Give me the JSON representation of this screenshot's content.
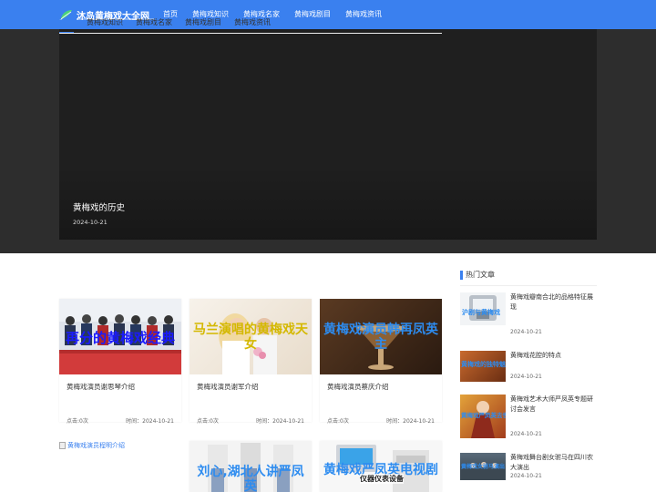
{
  "site": {
    "logo_text": "沐岛黄梅戏大全网"
  },
  "nav": [
    "首页",
    "黄梅戏知识",
    "黄梅戏名家",
    "黄梅戏剧目",
    "黄梅戏资讯"
  ],
  "hero": {
    "title": "黄梅戏的历史",
    "date": "2024-10-21"
  },
  "tabs": [
    "推荐",
    "黄梅戏知识",
    "黄梅戏名家",
    "黄梅戏剧目",
    "黄梅戏资讯"
  ],
  "cards": [
    {
      "overlay": "再分的黄梅戏经典",
      "overlay_color": "#1a1aff",
      "title": "黄梅戏演员谢思琴介绍",
      "clicks": "点击:0次",
      "time": "时间：2024-10-21"
    },
    {
      "overlay": "马兰演唱的黄梅戏天女",
      "overlay_color": "#d4b800",
      "title": "黄梅戏演员谢军介绍",
      "clicks": "点击:0次",
      "time": "时间：2024-10-21"
    },
    {
      "overlay": "黄梅戏演员韩再凤英主",
      "overlay_color": "#2d8cf0",
      "title": "黄梅戏演员蔡庆介绍",
      "clicks": "点击:0次",
      "time": "时间：2024-10-21"
    },
    {
      "overlay": "刘心,湖北人讲严凤英",
      "overlay_color": "#2d8cf0"
    },
    {
      "overlay": "黄梅戏严凤英电视剧",
      "overlay_color": "#2d8cf0",
      "tag": "仪器仪表设备"
    }
  ],
  "broken_image_alt": "黄梅戏演员程明介绍",
  "sidebar": {
    "title": "热门文章",
    "items": [
      {
        "title": "黄梅戏瓣南合北的品格特征展现",
        "date": "2024-10-21",
        "thumb_text": "沪剧与黄梅戏"
      },
      {
        "title": "黄梅戏花腔的特点",
        "date": "2024-10-21",
        "thumb_text": "黄梅戏的独特魅力"
      },
      {
        "title": "黄梅戏艺术大师严凤英专题研讨会发言",
        "date": "2024-10-21",
        "thumb_text": "黄梅戏严凤英去世"
      },
      {
        "title": "黄梅戏舞台剧女驸马在四川农大演出",
        "date": "2024-10-21",
        "thumb_text": "黄梅戏女驸马演出"
      }
    ]
  },
  "colors": {
    "accent": "#3a80ef",
    "hero_bg": "#2d2d2d"
  }
}
